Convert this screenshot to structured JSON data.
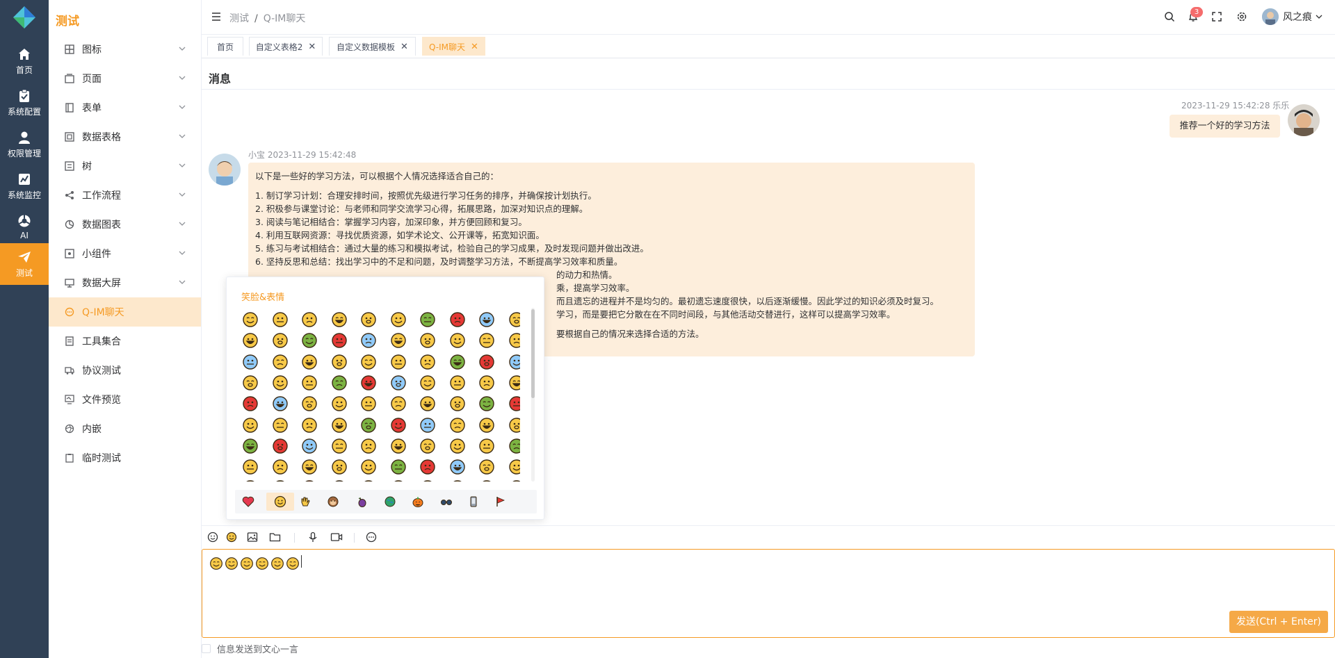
{
  "rail": {
    "items": [
      {
        "label": "首页",
        "icon": "home-icon"
      },
      {
        "label": "系统配置",
        "icon": "clipboard-check-icon"
      },
      {
        "label": "权限管理",
        "icon": "user-icon"
      },
      {
        "label": "系统监控",
        "icon": "chart-icon"
      },
      {
        "label": "AI",
        "icon": "ai-swirl-icon"
      },
      {
        "label": "测试",
        "icon": "paper-plane-icon"
      }
    ]
  },
  "menu": {
    "title": "测试",
    "items": [
      {
        "label": "图标"
      },
      {
        "label": "页面"
      },
      {
        "label": "表单"
      },
      {
        "label": "数据表格"
      },
      {
        "label": "树"
      },
      {
        "label": "工作流程"
      },
      {
        "label": "数据图表"
      },
      {
        "label": "小组件"
      },
      {
        "label": "数据大屏"
      },
      {
        "label": "Q-IM聊天"
      },
      {
        "label": "工具集合"
      },
      {
        "label": "协议测试"
      },
      {
        "label": "文件预览"
      },
      {
        "label": "内嵌"
      },
      {
        "label": "临时测试"
      }
    ]
  },
  "header": {
    "breadcrumb": [
      "测试",
      "Q-IM聊天"
    ],
    "notification_count": "3",
    "user_name": "风之痕"
  },
  "tabs": [
    {
      "label": "首页"
    },
    {
      "label": "自定义表格2"
    },
    {
      "label": "自定义数据模板"
    },
    {
      "label": "Q-IM聊天"
    }
  ],
  "chat": {
    "title": "消息",
    "my_message": {
      "time": "2023-11-29 15:42:28",
      "sender": "乐乐",
      "text": "推荐一个好的学习方法"
    },
    "bot_message": {
      "sender": "小宝",
      "time": "2023-11-29 15:42:48",
      "intro": "以下是一些好的学习方法，可以根据个人情况选择适合自己的：",
      "lines": [
        "1. 制订学习计划：合理安排时间，按照优先级进行学习任务的排序，并确保按计划执行。",
        "2. 积极参与课堂讨论：与老师和同学交流学习心得，拓展思路，加深对知识点的理解。",
        "3. 阅读与笔记相结合：掌握学习内容，加深印象，并方便回顾和复习。",
        "4. 利用互联网资源：寻找优质资源，如学术论文、公开课等，拓宽知识面。",
        "5. 练习与考试相结合：通过大量的练习和模拟考试，检验自己的学习成果，及时发现问题并做出改进。",
        "6. 坚持反思和总结：找出学习中的不足和问题，及时调整学习方法，不断提高学习效率和质量。"
      ],
      "visible_fragments": [
        "的动力和热情。",
        "乘，提高学习效率。",
        "而且遗忘的进程并不是均匀的。最初遗忘速度很快，以后逐渐缓慢。因此学过的知识必须及时复习。",
        "学习，而是要把它分散在在不同时间段，与其他活动交替进行，这样可以提高学习效率。",
        "要根据自己的情况来选择合适的方法。"
      ]
    }
  },
  "emoji_panel": {
    "category_title": "笑脸&表情",
    "categories": [
      "heart-icon",
      "smile-icon",
      "hand-icon",
      "monkey-icon",
      "eggplant-icon",
      "globe-icon",
      "pumpkin-icon",
      "glasses-icon",
      "phone-icon",
      "flag-icon"
    ],
    "colors": {
      "face": "#f7c948",
      "outline": "#3b2a14",
      "green": "#7cb342",
      "red": "#e53935",
      "blue": "#90caf9"
    }
  },
  "composer": {
    "emoji_count": 6,
    "send_label": "发送(Ctrl + Enter)"
  },
  "footer": {
    "checkbox_label": "信息发送到文心一言"
  },
  "colors": {
    "accent": "#f59a23",
    "rail_bg": "#304156",
    "bubble": "#fdeedc"
  }
}
